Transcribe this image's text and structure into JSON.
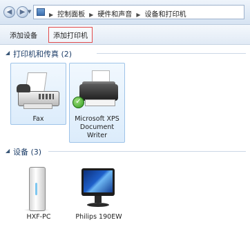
{
  "address_bar": {
    "back_icon": "back-arrow-icon",
    "forward_icon": "forward-arrow-icon",
    "breadcrumb": [
      "控制面板",
      "硬件和声音",
      "设备和打印机"
    ]
  },
  "toolbar": {
    "add_device": "添加设备",
    "add_printer": "添加打印机",
    "highlight_color": "#e24a4a"
  },
  "groups": {
    "printers": {
      "title": "打印机和传真 (2)",
      "items": [
        {
          "label": "Fax",
          "icon": "fax-machine-icon"
        },
        {
          "label_lines": [
            "Microsoft XPS",
            "Document",
            "Writer"
          ],
          "icon": "printer-icon",
          "default_badge": "checkmark-icon"
        }
      ]
    },
    "devices": {
      "title": "设备 (3)",
      "items": [
        {
          "label": "HXF-PC",
          "icon": "computer-tower-icon"
        },
        {
          "label": "Philips 190EW",
          "icon": "monitor-icon"
        }
      ]
    }
  },
  "colors": {
    "group_title": "#1b3c67",
    "selection_border": "#9ec3e8"
  }
}
